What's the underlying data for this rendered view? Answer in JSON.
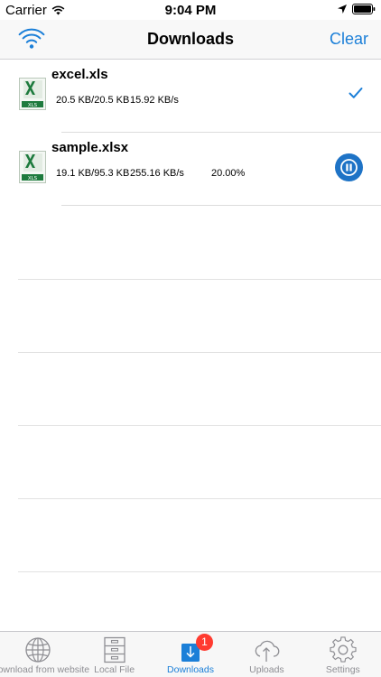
{
  "status_bar": {
    "carrier": "Carrier",
    "time": "9:04 PM"
  },
  "nav": {
    "title": "Downloads",
    "clear_label": "Clear",
    "left_icon": "wifi-icon"
  },
  "downloads": [
    {
      "name": "excel.xls",
      "size": "20.5 KB/20.5 KB",
      "speed": "15.92 KB/s",
      "percent": "",
      "state": "complete",
      "icon": "xls-file-icon",
      "icon_label": "XLS"
    },
    {
      "name": "sample.xlsx",
      "size": "19.1 KB/95.3 KB",
      "speed": "255.16 KB/s",
      "percent": "20.00%",
      "state": "downloading",
      "icon": "xls-file-icon",
      "icon_label": "XLS"
    }
  ],
  "tabs": [
    {
      "label": "Download from website",
      "icon": "globe-icon",
      "active": false
    },
    {
      "label": "Local File",
      "icon": "file-cabinet-icon",
      "active": false
    },
    {
      "label": "Downloads",
      "icon": "download-icon",
      "active": true,
      "badge": "1"
    },
    {
      "label": "Uploads",
      "icon": "cloud-upload-icon",
      "active": false
    },
    {
      "label": "Settings",
      "icon": "gear-icon",
      "active": false
    }
  ],
  "colors": {
    "accent": "#1b7fd8",
    "pause_button": "#1e73c6",
    "badge": "#ff3b30",
    "excel_green": "#1e7b3e"
  }
}
